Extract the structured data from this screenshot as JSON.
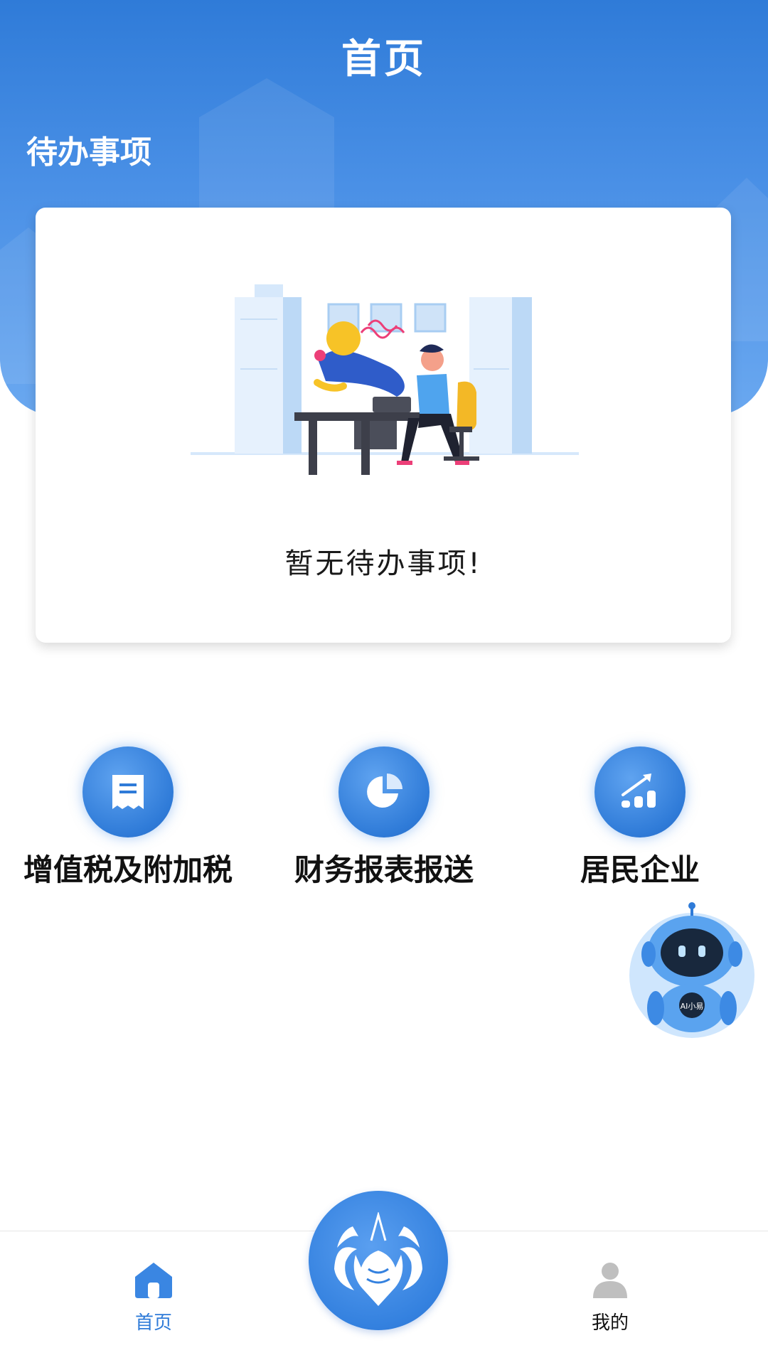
{
  "header": {
    "title": "首页"
  },
  "todo": {
    "section_title": "待办事项",
    "empty_text": "暂无待办事项!"
  },
  "actions": [
    {
      "label": "增值税及附加税",
      "icon": "receipt-icon"
    },
    {
      "label": "财务报表报送",
      "icon": "pie-chart-icon"
    },
    {
      "label": "居民企业",
      "icon": "growth-chart-icon"
    }
  ],
  "assistant": {
    "badge_text": "AI小易"
  },
  "bottom_nav": {
    "items": [
      {
        "label": "首页",
        "icon": "home-icon",
        "active": true
      },
      {
        "label": "我的",
        "icon": "user-icon",
        "active": false
      }
    ],
    "center_icon": "lobster-logo-icon"
  },
  "colors": {
    "primary": "#2f7bd8",
    "header_gradient_start": "#2f7bd8",
    "header_gradient_end": "#6aa8f0",
    "inactive": "#bfbfbf"
  }
}
